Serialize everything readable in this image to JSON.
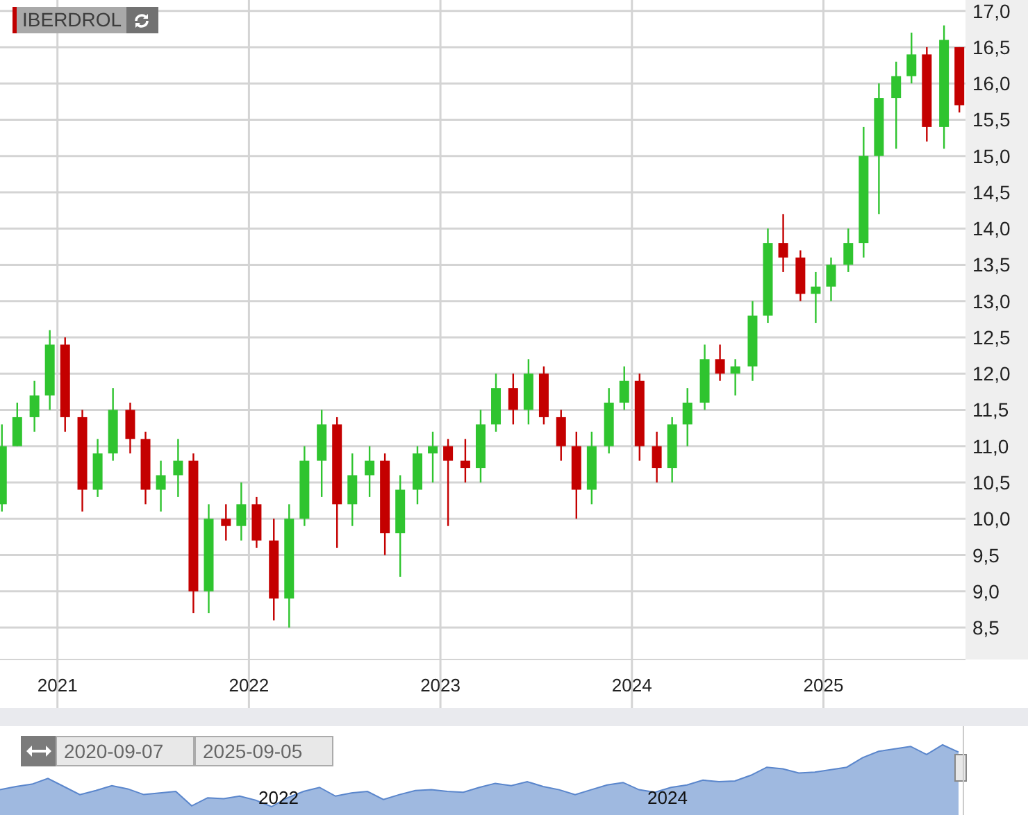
{
  "chart": {
    "chart_data": {
      "type": "candlestick",
      "title": "IBERDROL",
      "grid": true,
      "xlim": [
        2020.7,
        2025.742
      ],
      "ylim": [
        8.06,
        17.15
      ],
      "x": [
        2020.71,
        2020.79,
        2020.88,
        2020.96,
        2021.04,
        2021.13,
        2021.21,
        2021.29,
        2021.38,
        2021.46,
        2021.54,
        2021.63,
        2021.71,
        2021.79,
        2021.88,
        2021.96,
        2022.04,
        2022.13,
        2022.21,
        2022.29,
        2022.38,
        2022.46,
        2022.54,
        2022.63,
        2022.71,
        2022.79,
        2022.88,
        2022.96,
        2023.04,
        2023.13,
        2023.21,
        2023.29,
        2023.38,
        2023.46,
        2023.54,
        2023.63,
        2023.71,
        2023.79,
        2023.88,
        2023.96,
        2024.04,
        2024.13,
        2024.21,
        2024.29,
        2024.38,
        2024.46,
        2024.54,
        2024.63,
        2024.71,
        2024.79,
        2024.88,
        2024.96,
        2025.04,
        2025.13,
        2025.21,
        2025.29,
        2025.38,
        2025.46,
        2025.54,
        2025.63,
        2025.71
      ],
      "ohlc": [
        [
          10.2,
          11.3,
          10.1,
          11.0
        ],
        [
          11.0,
          11.6,
          11.0,
          11.4
        ],
        [
          11.4,
          11.9,
          11.2,
          11.7
        ],
        [
          11.7,
          12.6,
          11.5,
          12.4
        ],
        [
          12.4,
          12.5,
          11.2,
          11.4
        ],
        [
          11.4,
          11.5,
          10.1,
          10.4
        ],
        [
          10.4,
          11.1,
          10.3,
          10.9
        ],
        [
          10.9,
          11.8,
          10.8,
          11.5
        ],
        [
          11.5,
          11.6,
          10.9,
          11.1
        ],
        [
          11.1,
          11.2,
          10.2,
          10.4
        ],
        [
          10.4,
          10.8,
          10.1,
          10.6
        ],
        [
          10.6,
          11.1,
          10.3,
          10.8
        ],
        [
          10.8,
          10.9,
          8.7,
          9.0
        ],
        [
          9.0,
          10.2,
          8.7,
          10.0
        ],
        [
          10.0,
          10.2,
          9.7,
          9.9
        ],
        [
          9.9,
          10.5,
          9.7,
          10.2
        ],
        [
          10.2,
          10.3,
          9.6,
          9.7
        ],
        [
          9.7,
          10.0,
          8.6,
          8.9
        ],
        [
          8.9,
          10.2,
          8.5,
          10.0
        ],
        [
          10.0,
          11.0,
          9.9,
          10.8
        ],
        [
          10.8,
          11.5,
          10.3,
          11.3
        ],
        [
          11.3,
          11.4,
          9.6,
          10.2
        ],
        [
          10.2,
          10.9,
          9.9,
          10.6
        ],
        [
          10.6,
          11.0,
          10.3,
          10.8
        ],
        [
          10.8,
          10.9,
          9.5,
          9.8
        ],
        [
          9.8,
          10.6,
          9.2,
          10.4
        ],
        [
          10.4,
          11.0,
          10.2,
          10.9
        ],
        [
          10.9,
          11.2,
          10.5,
          11.0
        ],
        [
          11.0,
          11.1,
          9.9,
          10.8
        ],
        [
          10.8,
          11.1,
          10.5,
          10.7
        ],
        [
          10.7,
          11.5,
          10.5,
          11.3
        ],
        [
          11.3,
          12.0,
          11.2,
          11.8
        ],
        [
          11.8,
          12.0,
          11.3,
          11.5
        ],
        [
          11.5,
          12.2,
          11.3,
          12.0
        ],
        [
          12.0,
          12.1,
          11.3,
          11.4
        ],
        [
          11.4,
          11.5,
          10.8,
          11.0
        ],
        [
          11.0,
          11.2,
          10.0,
          10.4
        ],
        [
          10.4,
          11.2,
          10.2,
          11.0
        ],
        [
          11.0,
          11.8,
          10.9,
          11.6
        ],
        [
          11.6,
          12.1,
          11.5,
          11.9
        ],
        [
          11.9,
          12.0,
          10.8,
          11.0
        ],
        [
          11.0,
          11.2,
          10.5,
          10.7
        ],
        [
          10.7,
          11.4,
          10.5,
          11.3
        ],
        [
          11.3,
          11.8,
          11.0,
          11.6
        ],
        [
          11.6,
          12.4,
          11.5,
          12.2
        ],
        [
          12.2,
          12.4,
          11.9,
          12.0
        ],
        [
          12.0,
          12.2,
          11.7,
          12.1
        ],
        [
          12.1,
          13.0,
          11.9,
          12.8
        ],
        [
          12.8,
          14.0,
          12.7,
          13.8
        ],
        [
          13.8,
          14.2,
          13.4,
          13.6
        ],
        [
          13.6,
          13.7,
          13.0,
          13.1
        ],
        [
          13.1,
          13.4,
          12.7,
          13.2
        ],
        [
          13.2,
          13.6,
          13.0,
          13.5
        ],
        [
          13.5,
          14.0,
          13.4,
          13.8
        ],
        [
          13.8,
          15.4,
          13.6,
          15.0
        ],
        [
          15.0,
          16.0,
          14.2,
          15.8
        ],
        [
          15.8,
          16.3,
          15.1,
          16.1
        ],
        [
          16.1,
          16.7,
          16.0,
          16.4
        ],
        [
          16.4,
          16.5,
          15.2,
          15.4
        ],
        [
          15.4,
          16.8,
          15.1,
          16.6
        ],
        [
          16.5,
          16.5,
          15.6,
          15.7
        ]
      ],
      "xticks": [
        {
          "value": 2021,
          "label": "2021"
        },
        {
          "value": 2022,
          "label": "2022"
        },
        {
          "value": 2023,
          "label": "2023"
        },
        {
          "value": 2024,
          "label": "2024"
        },
        {
          "value": 2025,
          "label": "2025"
        }
      ],
      "yticks": [
        {
          "value": 8.5,
          "label": "8,5"
        },
        {
          "value": 9,
          "label": "9,0"
        },
        {
          "value": 9.5,
          "label": "9,5"
        },
        {
          "value": 10,
          "label": "10,0"
        },
        {
          "value": 10.5,
          "label": "10,5"
        },
        {
          "value": 11,
          "label": "11,0"
        },
        {
          "value": 11.5,
          "label": "11,5"
        },
        {
          "value": 12,
          "label": "12,0"
        },
        {
          "value": 12.5,
          "label": "12,5"
        },
        {
          "value": 13,
          "label": "13,0"
        },
        {
          "value": 13.5,
          "label": "13,5"
        },
        {
          "value": 14,
          "label": "14,0"
        },
        {
          "value": 14.5,
          "label": "14,5"
        },
        {
          "value": 15,
          "label": "15,0"
        },
        {
          "value": 15.5,
          "label": "15,5"
        },
        {
          "value": 16,
          "label": "16,0"
        },
        {
          "value": 16.5,
          "label": "16,5"
        },
        {
          "value": 17,
          "label": "17,0"
        }
      ]
    }
  },
  "navigator": {
    "from": "2020-09-07",
    "to": "2025-09-05",
    "ticks": [
      "2022",
      "2024"
    ]
  }
}
